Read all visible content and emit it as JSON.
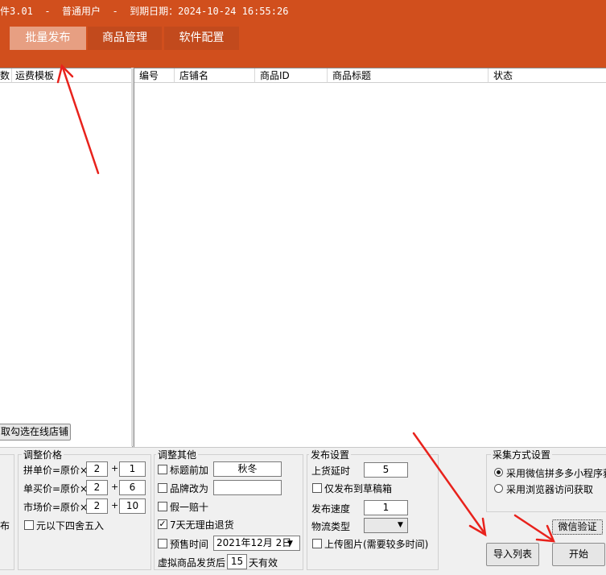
{
  "header": {
    "title": "件3.01  -  普通用户  -  到期日期：2024-10-24 16:55:26",
    "tabs": [
      {
        "label": "批量发布",
        "active": true
      },
      {
        "label": "商品管理",
        "active": false
      },
      {
        "label": "软件配置",
        "active": false
      }
    ]
  },
  "left_grid": {
    "columns": [
      "数",
      "运费模板"
    ],
    "get_button": "取勾选在线店铺"
  },
  "right_grid": {
    "columns": [
      "编号",
      "店铺名",
      "商品ID",
      "商品标题",
      "状态"
    ]
  },
  "left_partial_label": "布",
  "price": {
    "title": "调整价格",
    "rows": [
      {
        "label": "拼单价=原价×",
        "mult": "2",
        "add": "1"
      },
      {
        "label": "单买价=原价×",
        "mult": "2",
        "add": "6"
      },
      {
        "label": "市场价=原价×",
        "mult": "2",
        "add": "10"
      }
    ],
    "plus": "+",
    "round_label": "元以下四舍五入",
    "round_checked": false
  },
  "other": {
    "title": "调整其他",
    "title_prefix_label": "标题前加",
    "title_prefix_value": "秋冬",
    "title_prefix_checked": false,
    "brand_label": "品牌改为",
    "brand_value": "",
    "brand_checked": false,
    "fake_label": "假一赔十",
    "fake_checked": false,
    "return_label": "7天无理由退货",
    "return_checked": true,
    "presale_label": "预售时间",
    "presale_checked": false,
    "presale_date": "2021年12月  2日",
    "virtual_prefix": "虚拟商品发货后",
    "virtual_days": "15",
    "virtual_suffix": "天有效"
  },
  "publish": {
    "title": "发布设置",
    "delay_label": "上货延时",
    "delay_value": "5",
    "draft_label": "仅发布到草稿箱",
    "draft_checked": false,
    "speed_label": "发布速度",
    "speed_value": "1",
    "logistics_label": "物流类型",
    "logistics_value": "",
    "upload_label": "上传图片(需要较多时间)",
    "upload_checked": false
  },
  "collect": {
    "title": "采集方式设置",
    "options": [
      {
        "label": "采用微信拼多多小程序获",
        "selected": true
      },
      {
        "label": "采用浏览器访问获取",
        "selected": false
      }
    ],
    "wechat_button": "微信验证"
  },
  "actions": {
    "import_button": "导入列表",
    "start_button": "开始"
  },
  "colors": {
    "header": "#d14f1d",
    "active_tab": "#e79f82",
    "arrow": "#e8221c"
  }
}
